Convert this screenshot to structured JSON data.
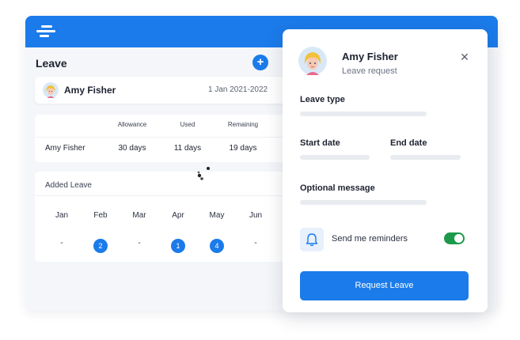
{
  "colors": {
    "accent": "#1b7bea",
    "toggle_on": "#1c9a4b"
  },
  "app": {
    "title": "Leave",
    "add_icon": "plus-icon",
    "user": {
      "name": "Amy Fisher",
      "period": "1 Jan 2021-2022"
    },
    "stats": {
      "headers": [
        "Allowance",
        "Used",
        "Remaining"
      ],
      "row": {
        "name": "Amy Fisher",
        "allowance": "30 days",
        "used": "11 days",
        "remaining": "19 days"
      }
    },
    "added_leave": {
      "title": "Added Leave",
      "months": [
        "Jan",
        "Feb",
        "Mar",
        "Apr",
        "May",
        "Jun"
      ],
      "values": [
        "-",
        "2",
        "-",
        "1",
        "4",
        "-"
      ]
    }
  },
  "panel": {
    "name": "Amy Fisher",
    "subtitle": "Leave request",
    "close_icon": "close-icon",
    "leave_type_label": "Leave type",
    "start_date_label": "Start date",
    "end_date_label": "End date",
    "message_label": "Optional message",
    "reminder_label": "Send me reminders",
    "reminder_on": true,
    "request_button": "Request Leave"
  }
}
